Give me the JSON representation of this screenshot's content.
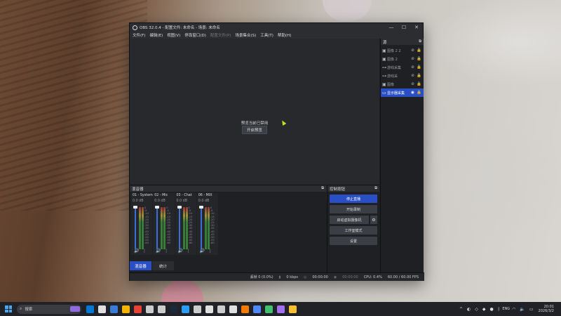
{
  "window": {
    "title": "OBS 32.0.4 - 配置文件: 未命名 - 场景: 未命名",
    "minimize": "—",
    "maximize": "☐",
    "close": "✕"
  },
  "menu": [
    {
      "label": "文件(F)",
      "disabled": false
    },
    {
      "label": "编辑(E)",
      "disabled": false
    },
    {
      "label": "视图(V)",
      "disabled": false
    },
    {
      "label": "停靠窗口(D)",
      "disabled": false
    },
    {
      "label": "配置文件(P)",
      "disabled": true
    },
    {
      "label": "场景集合(S)",
      "disabled": false
    },
    {
      "label": "工具(T)",
      "disabled": false
    },
    {
      "label": "帮助(H)",
      "disabled": false
    }
  ],
  "preview": {
    "message": "预览当前已禁用",
    "enable_button": "开启预览"
  },
  "sources": {
    "header": "源",
    "items": [
      {
        "name": "图像 2 2",
        "icon": "image-icon",
        "active": false
      },
      {
        "name": "图像 2",
        "icon": "image-icon",
        "active": false
      },
      {
        "name": "游戏采集",
        "icon": "gamepad-icon",
        "active": false
      },
      {
        "name": "游戏采",
        "icon": "gamepad-icon",
        "active": false
      },
      {
        "name": "图像",
        "icon": "image-icon",
        "active": false
      },
      {
        "name": "显示器采集",
        "icon": "monitor-icon",
        "active": true
      }
    ]
  },
  "mixer": {
    "header": "混音器",
    "channels": [
      {
        "name": "01 - System",
        "db": "0.0 dB"
      },
      {
        "name": "02 - Mic",
        "db": "0.0 dB"
      },
      {
        "name": "03 - Chat",
        "db": "0.0 dB"
      },
      {
        "name": "06 - MIX",
        "db": "0.0 dB"
      }
    ],
    "scale": [
      "0",
      "-5",
      "-10",
      "-15",
      "-20",
      "-25",
      "-30",
      "-35",
      "-40",
      "-45",
      "-50",
      "-55",
      "-60"
    ],
    "tabs": [
      "混音器",
      "统计"
    ]
  },
  "controls": {
    "header": "控制按钮",
    "stop_stream": "停止直播",
    "start_record": "开始录制",
    "virtual_cam": "启动虚拟摄像机",
    "studio_mode": "工作室模式",
    "settings": "设置"
  },
  "status": {
    "dropped": "丢帧 0 (0.0%)",
    "kbps": "0 kbps",
    "stream_time": "00:00:00",
    "rec_time": "00:00:00",
    "cpu": "CPU: 0.4%",
    "fps": "60.00 / 60.00 FPS"
  },
  "taskbar": {
    "search_placeholder": "搜索",
    "language": "ENG",
    "time": "20:01",
    "date": "2026/3/2",
    "icon_colors": [
      "#0078d4",
      "#e0e0e0",
      "#3a7bd5",
      "#f4b400",
      "#e94235",
      "#cccccc",
      "#cccccc",
      "#1b2838",
      "#2a9df4",
      "#cccccc",
      "#e0e0e0",
      "#cccccc",
      "#e0e0e0",
      "#f57c00",
      "#4f88ff",
      "#40c070",
      "#a070f0",
      "#f8c030"
    ]
  }
}
